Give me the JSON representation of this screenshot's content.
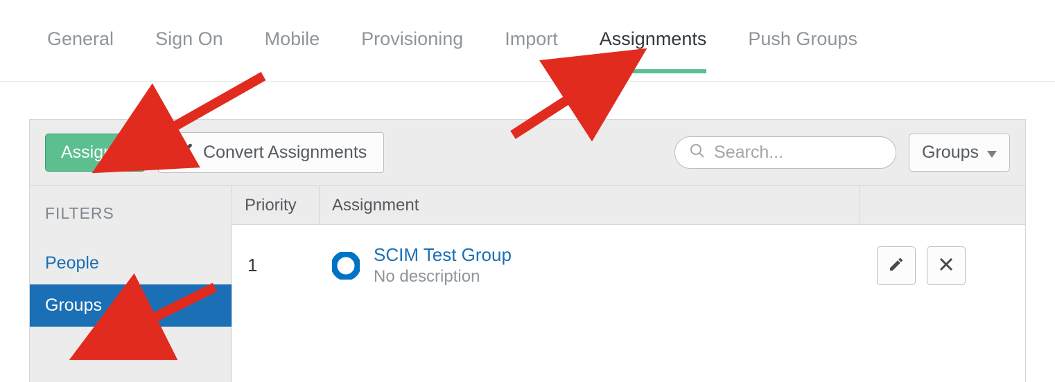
{
  "tabs": [
    {
      "label": "General",
      "active": false
    },
    {
      "label": "Sign On",
      "active": false
    },
    {
      "label": "Mobile",
      "active": false
    },
    {
      "label": "Provisioning",
      "active": false
    },
    {
      "label": "Import",
      "active": false
    },
    {
      "label": "Assignments",
      "active": true
    },
    {
      "label": "Push Groups",
      "active": false
    }
  ],
  "toolbar": {
    "assign_label": "Assign",
    "convert_label": "Convert Assignments",
    "scope_label": "Groups"
  },
  "search": {
    "placeholder": "Search..."
  },
  "sidebar": {
    "filters_label": "FILTERS",
    "items": [
      {
        "label": "People",
        "selected": false
      },
      {
        "label": "Groups",
        "selected": true
      }
    ]
  },
  "headers": {
    "priority": "Priority",
    "assignment": "Assignment"
  },
  "rows": [
    {
      "priority": "1",
      "name": "SCIM Test Group",
      "description": "No description"
    }
  ]
}
